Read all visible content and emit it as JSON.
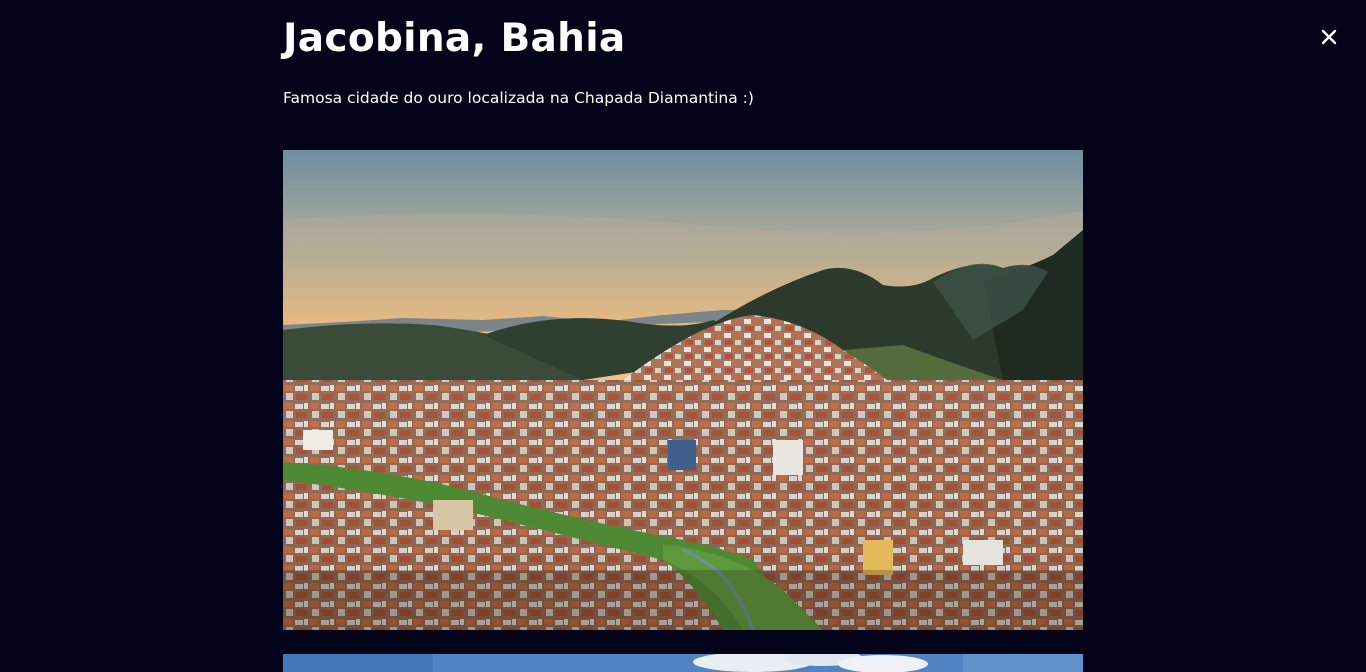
{
  "modal": {
    "title": "Jacobina, Bahia",
    "description": "Famosa cidade do ouro localizada na Chapada Diamantina :)",
    "close_icon": "close-icon",
    "background_color": "#03041a"
  },
  "gallery": {
    "photos": [
      {
        "icon": "landscape-photo",
        "subject": "aerial-city-mountains-sunset"
      },
      {
        "icon": "landscape-photo",
        "subject": "blue-sky-clouds"
      }
    ]
  }
}
